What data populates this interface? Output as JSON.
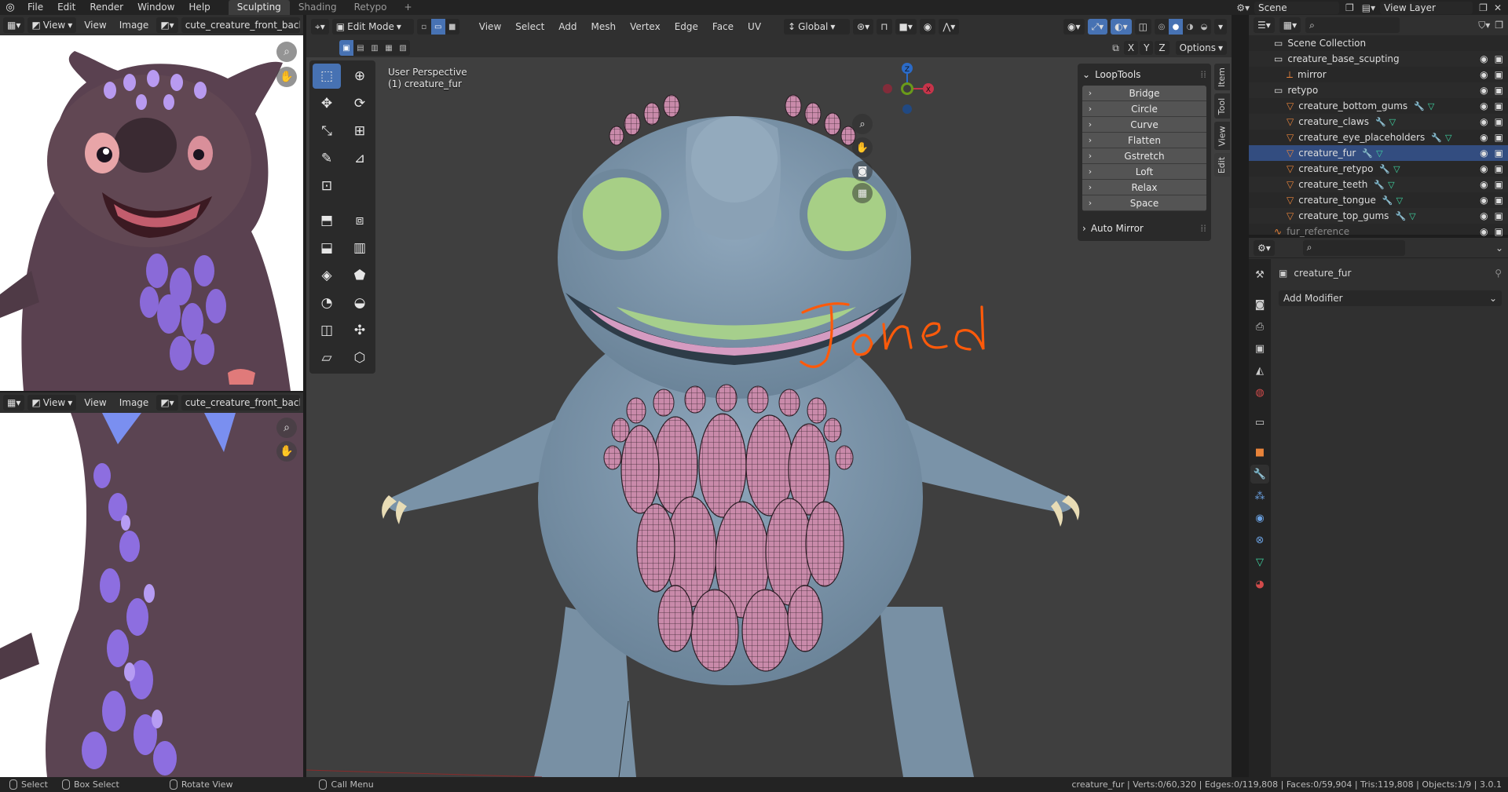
{
  "topbar": {
    "menus": [
      "File",
      "Edit",
      "Render",
      "Window",
      "Help"
    ],
    "workspaces": [
      {
        "label": "Sculpting",
        "active": true
      },
      {
        "label": "Shading",
        "active": false
      },
      {
        "label": "Retypo",
        "active": false
      }
    ],
    "add_tab": "+",
    "scene_label": "Scene",
    "view_layer_label": "View Layer"
  },
  "image_editor_top": {
    "view_label": "View",
    "menus": [
      "View",
      "Image"
    ],
    "image_name": "cute_creature_front_back."
  },
  "image_editor_bottom": {
    "view_label": "View",
    "menus": [
      "View",
      "Image"
    ],
    "image_name": "cute_creature_front_back."
  },
  "viewport": {
    "mode_label": "Edit Mode",
    "menus": [
      "View",
      "Select",
      "Add",
      "Mesh",
      "Vertex",
      "Edge",
      "Face",
      "UV"
    ],
    "orientation_label": "Global",
    "axis_labels": [
      "X",
      "Y",
      "Z"
    ],
    "options_label": "Options",
    "perspective_label": "User Perspective",
    "object_label": "(1) creature_fur",
    "annotation_text": "Joined",
    "gizmo_axes": {
      "x": "X",
      "y": "Y",
      "z": "Z"
    }
  },
  "npanel": {
    "looptools_title": "LoopTools",
    "looptools_items": [
      "Bridge",
      "Circle",
      "Curve",
      "Flatten",
      "Gstretch",
      "Loft",
      "Relax",
      "Space"
    ],
    "auto_mirror_label": "Auto Mirror",
    "tabs": [
      "Item",
      "Tool",
      "View",
      "Edit"
    ]
  },
  "outliner": {
    "rows": [
      {
        "label": "Scene Collection",
        "indent": 2,
        "type": "collection",
        "selected": false
      },
      {
        "label": "creature_base_scupting",
        "indent": 2,
        "type": "collection",
        "selected": false
      },
      {
        "label": "mirror",
        "indent": 3,
        "type": "empty",
        "selected": false
      },
      {
        "label": "retypo",
        "indent": 2,
        "type": "collection",
        "selected": false
      },
      {
        "label": "creature_bottom_gums",
        "indent": 3,
        "type": "mesh",
        "selected": false
      },
      {
        "label": "creature_claws",
        "indent": 3,
        "type": "mesh",
        "selected": false
      },
      {
        "label": "creature_eye_placeholders",
        "indent": 3,
        "type": "mesh",
        "selected": false
      },
      {
        "label": "creature_fur",
        "indent": 3,
        "type": "mesh",
        "selected": true
      },
      {
        "label": "creature_retypo",
        "indent": 3,
        "type": "mesh",
        "selected": false
      },
      {
        "label": "creature_teeth",
        "indent": 3,
        "type": "mesh",
        "selected": false
      },
      {
        "label": "creature_tongue",
        "indent": 3,
        "type": "mesh",
        "selected": false
      },
      {
        "label": "creature_top_gums",
        "indent": 3,
        "type": "mesh",
        "selected": false
      },
      {
        "label": "fur_reference",
        "indent": 2,
        "type": "object",
        "selected": false
      }
    ]
  },
  "properties": {
    "object_name": "creature_fur",
    "add_modifier_label": "Add Modifier"
  },
  "statusbar": {
    "select_label": "Select",
    "box_select_label": "Box Select",
    "rotate_view_label": "Rotate View",
    "call_menu_label": "Call Menu",
    "stats": "creature_fur | Verts:0/60,320 | Edges:0/119,808 | Faces:0/59,904 | Tris:119,808 | Objects:1/9 | 3.0.1"
  },
  "colors": {
    "accent": "#4772b3",
    "creature_body": "#7f98ad",
    "scales": "#c98aaa",
    "eyes": "#a7cf86",
    "annotation": "#ff5a0a",
    "selected_row": "#334d80"
  }
}
